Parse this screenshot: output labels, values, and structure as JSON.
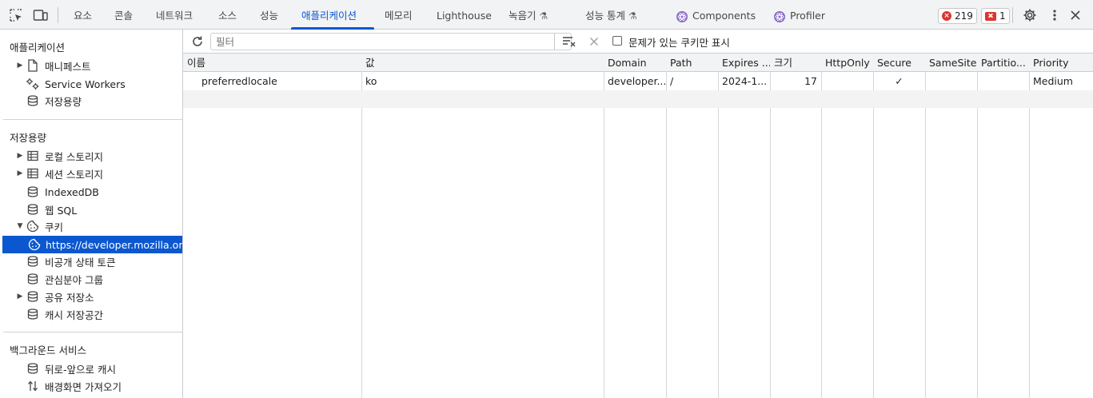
{
  "toolbar": {
    "tabs": [
      {
        "label": "요소"
      },
      {
        "label": "콘솔"
      },
      {
        "label": "네트워크"
      },
      {
        "label": "소스"
      },
      {
        "label": "성능"
      },
      {
        "label": "애플리케이션"
      },
      {
        "label": "메모리"
      },
      {
        "label": "Lighthouse"
      },
      {
        "label": "녹음기"
      },
      {
        "label": "성능 통계"
      },
      {
        "label": "Components"
      },
      {
        "label": "Profiler"
      }
    ],
    "active_tab": "애플리케이션",
    "errors_count": "219",
    "issues_count": "1",
    "icons": [
      "inspect-icon",
      "device-toggle-icon",
      "flask-icon",
      "react-icon",
      "gear-icon",
      "more-vert-icon",
      "close-icon"
    ]
  },
  "sidebar": {
    "sections": [
      {
        "title": "애플리케이션",
        "items": [
          {
            "label": "매니페스트",
            "icon": "document-icon",
            "expandable": true
          },
          {
            "label": "Service Workers",
            "icon": "gears-icon",
            "expandable": false
          },
          {
            "label": "저장용량",
            "icon": "database-icon",
            "expandable": false
          }
        ]
      },
      {
        "title": "저장용량",
        "items": [
          {
            "label": "로컬 스토리지",
            "icon": "table-icon",
            "expandable": true
          },
          {
            "label": "세션 스토리지",
            "icon": "table-icon",
            "expandable": true
          },
          {
            "label": "IndexedDB",
            "icon": "database-icon",
            "expandable": false
          },
          {
            "label": "웹 SQL",
            "icon": "database-icon",
            "expandable": false
          },
          {
            "label": "쿠키",
            "icon": "cookie-icon",
            "expandable": true,
            "expanded": true
          },
          {
            "label": "https://developer.mozilla.org",
            "icon": "cookie-icon",
            "selected": true,
            "child": true
          },
          {
            "label": "비공개 상태 토큰",
            "icon": "database-icon",
            "expandable": false
          },
          {
            "label": "관심분야 그룹",
            "icon": "database-icon",
            "expandable": false
          },
          {
            "label": "공유 저장소",
            "icon": "database-icon",
            "expandable": true
          },
          {
            "label": "캐시 저장공간",
            "icon": "database-icon",
            "expandable": false
          }
        ]
      },
      {
        "title": "백그라운드 서비스",
        "items": [
          {
            "label": "뒤로-앞으로 캐시",
            "icon": "database-icon",
            "expandable": false
          },
          {
            "label": "배경화면 가져오기",
            "icon": "sync-arrows-icon",
            "expandable": false
          }
        ]
      }
    ]
  },
  "filter_bar": {
    "placeholder": "필터",
    "checkbox_label": "문제가 있는 쿠키만 표시",
    "checkbox_checked": false,
    "icons": [
      "refresh-icon",
      "clear-filter-icon",
      "delete-icon"
    ]
  },
  "cookies_table": {
    "columns": [
      "이름",
      "값",
      "Domain",
      "Path",
      "Expires ...",
      "크기",
      "HttpOnly",
      "Secure",
      "SameSite",
      "Partitio...",
      "Priority"
    ],
    "rows": [
      {
        "name": "preferredlocale",
        "value": "ko",
        "domain": "developer....",
        "path": "/",
        "expires": "2024-1...",
        "size": "17",
        "httponly": "",
        "secure": "✓",
        "samesite": "",
        "partition": "",
        "priority": "Medium"
      }
    ]
  }
}
